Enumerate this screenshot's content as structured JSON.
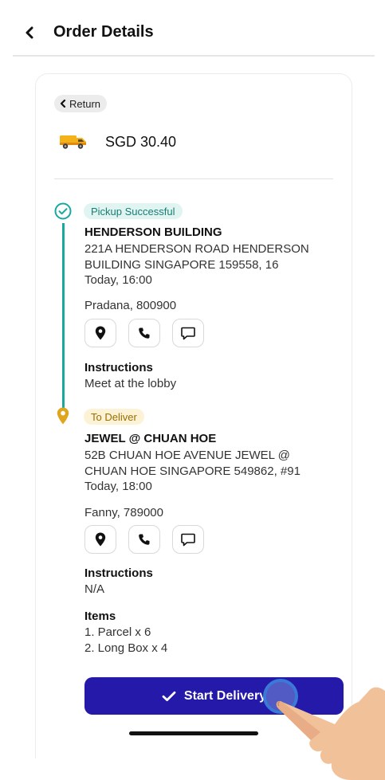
{
  "header": {
    "title": "Order Details"
  },
  "order": {
    "return_label": "Return",
    "price": "SGD 30.40"
  },
  "pickup": {
    "status": "Pickup Successful",
    "name": "HENDERSON BUILDING",
    "address_line1": "221A HENDERSON ROAD HENDERSON",
    "address_line2": "BUILDING SINGAPORE 159558, 16",
    "time": "Today, 16:00",
    "contact": "Pradana, 800900",
    "instructions_label": "Instructions",
    "instructions": "Meet at the lobby"
  },
  "delivery": {
    "status": "To Deliver",
    "name": "JEWEL @ CHUAN HOE",
    "address_line1": "52B CHUAN HOE AVENUE JEWEL @",
    "address_line2": "CHUAN HOE SINGAPORE 549862, #91",
    "time": "Today, 18:00",
    "contact": "Fanny, 789000",
    "instructions_label": "Instructions",
    "instructions": "N/A",
    "items_label": "Items",
    "items": [
      "1. Parcel x 6",
      "2. Long Box x 4"
    ]
  },
  "footer": {
    "start_button": "Start Delivery"
  },
  "colors": {
    "primary": "#2419a8",
    "success": "#17a8a0",
    "pending": "#e0a61b",
    "tap": "#3b79d6"
  }
}
